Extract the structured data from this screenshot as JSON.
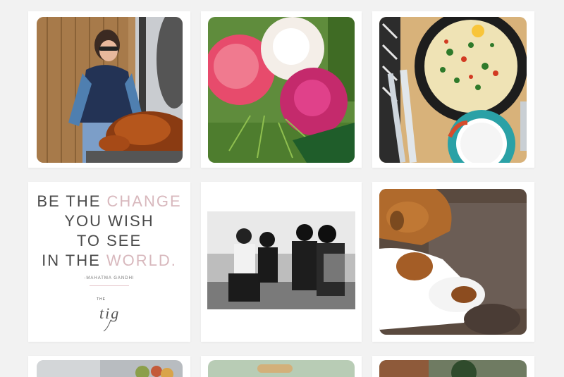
{
  "feed": {
    "posts": [
      {
        "description": "turkey"
      },
      {
        "description": "peonies"
      },
      {
        "description": "frittata"
      },
      {
        "description": "quote"
      },
      {
        "description": "bw-photo"
      },
      {
        "description": "dogs"
      }
    ]
  },
  "quote_card": {
    "line1_plain": "BE THE ",
    "line1_pink": "CHANGE",
    "line2": "YOU WISH",
    "line3": "TO SEE",
    "line4_plain": "IN THE ",
    "line4_pink": "WORLD.",
    "attribution": "-MAHATMA GANDHI",
    "logo_small": "THE",
    "logo_script": "tig"
  },
  "colors": {
    "background": "#f2f2f2",
    "card": "#ffffff",
    "accent_pink": "#d8b8bd",
    "text_gray": "#4a4a4a"
  }
}
